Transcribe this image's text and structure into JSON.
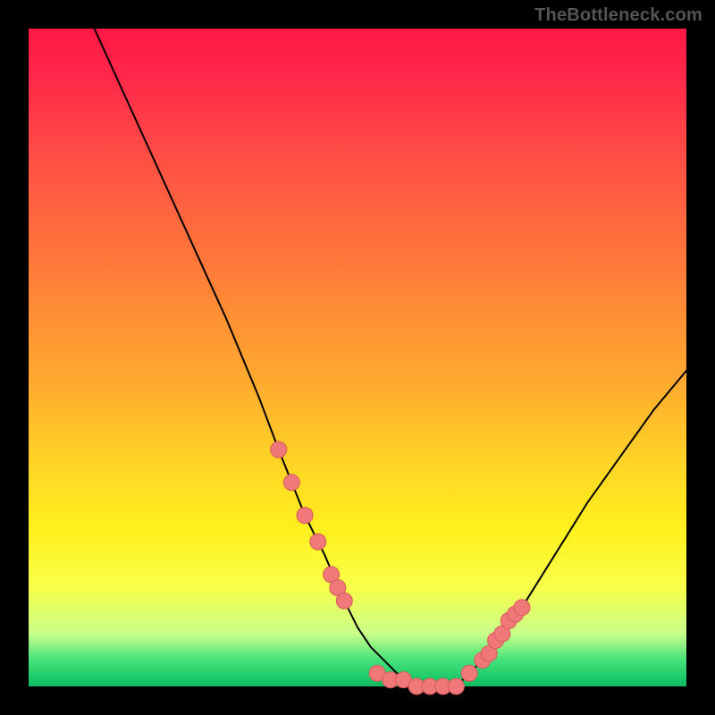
{
  "watermark": "TheBottleneck.com",
  "colors": {
    "background": "#000000",
    "gradient_top": "#ff1744",
    "gradient_mid": "#ffd426",
    "gradient_bottom": "#12b85e",
    "curve_stroke": "#000000",
    "marker_fill": "#f07878",
    "marker_stroke": "#d85a5a"
  },
  "chart_data": {
    "type": "line",
    "title": "",
    "xlabel": "",
    "ylabel": "",
    "xlim": [
      0,
      100
    ],
    "ylim": [
      0,
      100
    ],
    "grid": false,
    "legend": false,
    "background_gradient": "red-yellow-green (top to bottom)",
    "series": [
      {
        "name": "bottleneck-curve",
        "style": "line",
        "x": [
          10,
          15,
          20,
          25,
          30,
          35,
          38,
          40,
          42,
          45,
          48,
          50,
          52,
          55,
          57,
          60,
          62,
          65,
          67,
          70,
          75,
          80,
          85,
          90,
          95,
          100
        ],
        "y": [
          100,
          89,
          78,
          67,
          56,
          44,
          36,
          31,
          26,
          20,
          13,
          9,
          6,
          3,
          1,
          0,
          0,
          0,
          2,
          5,
          12,
          20,
          28,
          35,
          42,
          48
        ]
      },
      {
        "name": "left-cluster-markers",
        "style": "scatter",
        "x": [
          38,
          40,
          42,
          44,
          46,
          47,
          48
        ],
        "y": [
          36,
          31,
          26,
          22,
          17,
          15,
          13
        ]
      },
      {
        "name": "bottom-cluster-markers",
        "style": "scatter",
        "x": [
          53,
          55,
          57,
          59,
          61,
          63,
          65,
          67
        ],
        "y": [
          2,
          1,
          1,
          0,
          0,
          0,
          0,
          2
        ]
      },
      {
        "name": "right-cluster-markers",
        "style": "scatter",
        "x": [
          69,
          70,
          71,
          72,
          73,
          74,
          75
        ],
        "y": [
          4,
          5,
          7,
          8,
          10,
          11,
          12
        ]
      }
    ]
  }
}
